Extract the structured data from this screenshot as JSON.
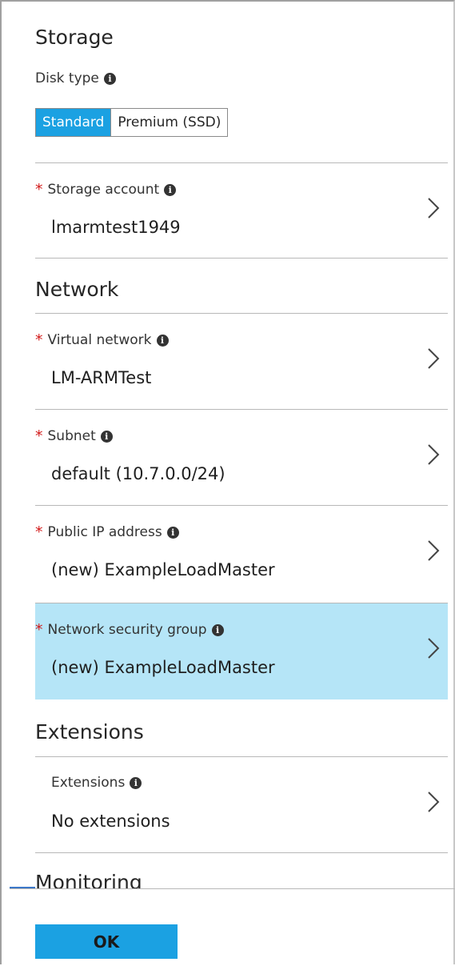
{
  "storage": {
    "section_title": "Storage",
    "disk_type_label": "Disk type",
    "disk_type_options": [
      "Standard",
      "Premium (SSD)"
    ],
    "disk_type_selected": "Standard",
    "storage_account": {
      "label": "Storage account",
      "value": "lmarmtest1949",
      "required": true
    }
  },
  "network": {
    "section_title": "Network",
    "virtual_network": {
      "label": "Virtual network",
      "value": "LM-ARMTest",
      "required": true
    },
    "subnet": {
      "label": "Subnet",
      "value": "default (10.7.0.0/24)",
      "required": true
    },
    "public_ip": {
      "label": "Public IP address",
      "value": "(new) ExampleLoadMaster",
      "required": true
    },
    "nsg": {
      "label": "Network security group",
      "value": "(new) ExampleLoadMaster",
      "required": true,
      "selected": true
    }
  },
  "extensions": {
    "section_title": "Extensions",
    "item": {
      "label": "Extensions",
      "value": "No extensions"
    }
  },
  "monitoring": {
    "section_title": "Monitoring"
  },
  "footer": {
    "ok_label": "OK"
  },
  "symbols": {
    "required_marker": "*",
    "info_glyph": "i"
  },
  "colors": {
    "accent": "#1ba1e2",
    "selected_row_bg": "#b5e5f7",
    "required_marker": "#d21a1a"
  },
  "icons": {
    "info": "info-icon",
    "chevron": "chevron-right-icon"
  }
}
